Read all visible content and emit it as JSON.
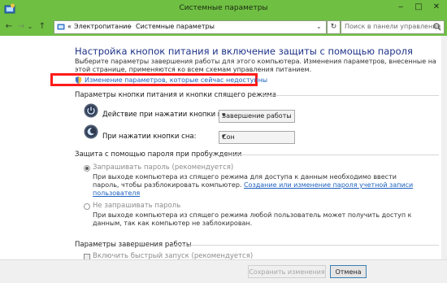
{
  "window": {
    "title": "Системные параметры",
    "minimize": "‒",
    "maximize": "□",
    "close": "✕"
  },
  "nav": {
    "back": "←",
    "forward": "→",
    "dropdown": "⌄",
    "up": "↑",
    "breadcrumb": [
      "Электропитание",
      "Системные параметры"
    ],
    "crumb_prefix": "«",
    "crumb_sep": "›",
    "refresh": "↻",
    "search_placeholder": "Поиск в панели управления"
  },
  "page": {
    "heading": "Настройка кнопок питания и включение защиты с помощью пароля",
    "intro_line1": "Выберите параметры завершения работы для этого компьютера. Изменения параметров, внесенные на",
    "intro_line2": "этой странице, применяются ко всем схемам управления питанием.",
    "change_unavailable_link": "Изменение параметров, которые сейчас недоступны"
  },
  "power_buttons": {
    "section_title": "Параметры кнопки питания и кнопки спящего режима",
    "power_label": "Действие при нажатии кнопки питания:",
    "power_value": "Завершение работы",
    "sleep_label": "При нажатии кнопки сна:",
    "sleep_value": "Сон"
  },
  "password": {
    "section_title": "Защита с помощью пароля при пробуждении",
    "require_label": "Запрашивать пароль (рекомендуется)",
    "require_desc_line1": "При выходе компьютера из спящего режима для доступа к данным необходимо ввести",
    "require_desc_line2": "пароль, чтобы разблокировать компьютер.",
    "require_link_part1": "Создание или изменение пароля учетной записи",
    "require_link_part2": "пользователя",
    "norequire_label": "Не запрашивать пароль",
    "norequire_desc_line1": "При выходе компьютера из спящего режима любой пользователь может получить доступ к",
    "norequire_desc_line2": "данным, так как компьютер не заблокирован."
  },
  "shutdown": {
    "section_title": "Параметры завершения работы",
    "fast_startup_label": "Включить быстрый запуск (рекомендуется)"
  },
  "footer": {
    "save_label": "Сохранить изменения",
    "cancel_label": "Отмена"
  },
  "colors": {
    "titlebar": "#6fbf43",
    "highlight_border": "#ff1b1b",
    "heading": "#1e3287",
    "link": "#1e62c0"
  }
}
